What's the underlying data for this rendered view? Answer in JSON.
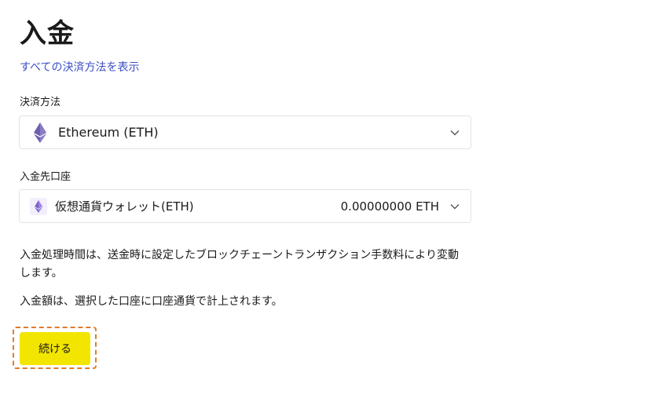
{
  "page": {
    "title": "入金",
    "show_all_link": "すべての決済方法を表示"
  },
  "payment_method": {
    "label": "決済方法",
    "selected": "Ethereum (ETH)",
    "icon": "ethereum-icon"
  },
  "deposit_account": {
    "label": "入金先口座",
    "selected": "仮想通貨ウォレット(ETH)",
    "balance": "0.00000000 ETH",
    "icon": "ethereum-icon"
  },
  "info": {
    "processing_time": "入金処理時間は、送金時に設定したブロックチェーントランザクション手数料により変動します。",
    "credit_note": "入金額は、選択した口座に口座通貨で計上されます。"
  },
  "actions": {
    "continue_label": "続ける"
  },
  "colors": {
    "accent": "#f2e500",
    "link": "#3b4fc4",
    "ethereum": "#6f5fae",
    "highlight": "#e07b2a"
  }
}
